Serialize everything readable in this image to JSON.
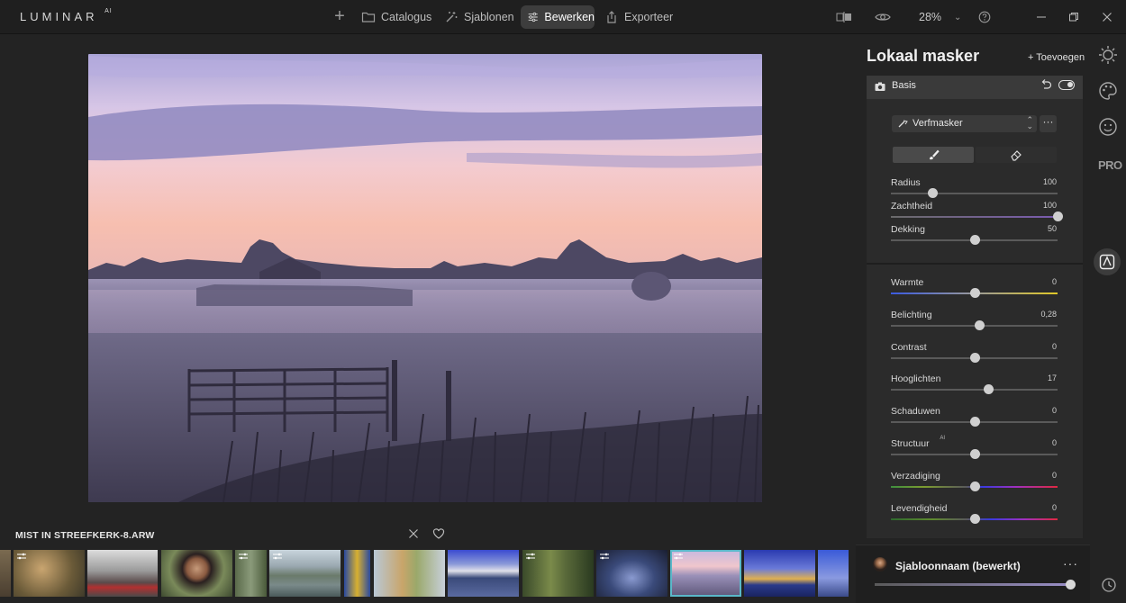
{
  "app": {
    "logo": "LUMINAR",
    "logo_sup": "AI"
  },
  "nav": {
    "catalogus": "Catalogus",
    "sjablonen": "Sjablonen",
    "bewerken": "Bewerken",
    "exporteer": "Exporteer"
  },
  "toolbar": {
    "zoom": "28%",
    "zoom_chevron": "⌄"
  },
  "filmstrip": {
    "title": "MIST IN STREEFKERK-8.ARW",
    "selected_index": 9
  },
  "panel": {
    "title": "Lokaal masker",
    "add_label": "+ Toevoegen",
    "basis_label": "Basis",
    "mask_type": "Verfmasker",
    "more": "···",
    "brush_sliders": [
      {
        "label": "Radius",
        "value": "100",
        "pos": 0.25
      },
      {
        "label": "Zachtheid",
        "value": "100",
        "pos": 1.0
      },
      {
        "label": "Dekking",
        "value": "50",
        "pos": 0.5
      }
    ],
    "adjust_sliders": [
      {
        "label": "Warmte",
        "value": "0",
        "pos": 0.5
      },
      {
        "label": "Belichting",
        "value": "0,28",
        "pos": 0.53
      },
      {
        "label": "Contrast",
        "value": "0",
        "pos": 0.5
      },
      {
        "label": "Hooglichten",
        "value": "17",
        "pos": 0.585
      },
      {
        "label": "Schaduwen",
        "value": "0",
        "pos": 0.5
      },
      {
        "label": "Structuur",
        "label_sup": "AI",
        "value": "0",
        "pos": 0.5
      },
      {
        "label": "Verzadiging",
        "value": "0",
        "pos": 0.5
      },
      {
        "label": "Levendigheid",
        "value": "0",
        "pos": 0.5
      }
    ]
  },
  "template_bar": {
    "name": "Sjabloonnaam (bewerkt)",
    "more": "···",
    "amount": 1.0
  },
  "rail": {
    "pro_label": "PRO"
  }
}
